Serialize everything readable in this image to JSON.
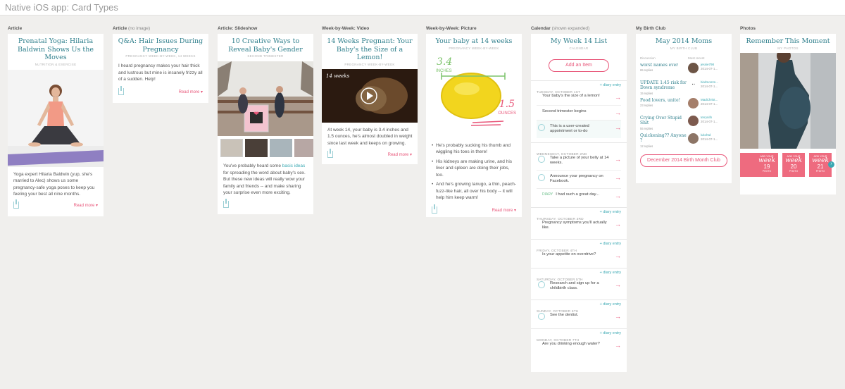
{
  "page": {
    "title": "Native iOS app: Card Types"
  },
  "columns": {
    "article": {
      "label": "Article",
      "note": ""
    },
    "qa": {
      "label": "Article",
      "note": "(no image)"
    },
    "slideshow": {
      "label": "Article: Slideshow",
      "note": ""
    },
    "video": {
      "label": "Week-by-Week: Video",
      "note": ""
    },
    "picture": {
      "label": "Week-by-Week: Picture",
      "note": ""
    },
    "calendar": {
      "label": "Calendar",
      "note": "(shown expanded)"
    },
    "club": {
      "label": "My Birth Club",
      "note": ""
    },
    "photos": {
      "label": "Photos",
      "note": ""
    }
  },
  "article": {
    "title": "Prenatal Yoga: Hilaria Baldwin Shows Us the Moves",
    "subtitle": "NUTRITION & EXERCISE",
    "body": "Yoga expert Hilaria Baldwin (yup, she's married to Alec) shows us some pregnancy-safe yoga poses to keep you feeling your best all nine months.",
    "read_more": "Read more"
  },
  "qa": {
    "title": "Q&A: Hair Issues During Pregnancy",
    "subtitle": "PREGNANCY WEEK-BY-WEEK, 14 WEEKS",
    "body": "I heard pregnancy makes your hair thick and lustrous but mine is insanely frizzy all of a sudden. Help!",
    "read_more": "Read more"
  },
  "slideshow": {
    "title": "10 Creative Ways to Reveal Baby's Gender",
    "subtitle": "SECOND TRIMESTER",
    "body_pre": "You've probably heard some ",
    "body_link": "basic ideas",
    "body_post": " for spreading the word about baby's sex. But these new ideas will really wow your family and friends -- and make sharing your surprise even more exciting."
  },
  "video": {
    "title": "14 Weeks Pregnant: Your Baby's the Size of a Lemon!",
    "subtitle": "PREGNANCY WEEK-BY-WEEK",
    "overlay": "14 weeks",
    "body": "At week 14, your baby is 3.4 inches and 1.5 ounces, he's almost doubled in weight since last week and keeps on growing.",
    "read_more": "Read more"
  },
  "picture": {
    "title": "Your baby at 14 weeks",
    "subtitle": "PREGNANCY WEEK-BY-WEEK",
    "inches_value": "3.4",
    "inches_label": "INCHES",
    "ounces_value": "1.5",
    "ounces_label": "OUNCES",
    "bullets": [
      "He's probably sucking his thumb and wiggling his toes in there!",
      "His kidneys are making urine, and his liver and spleen are doing their jobs, too.",
      "And he's growing lanugo, a thin, peach- fuzz-like hair, all over his body -- it will help him keep warm!"
    ],
    "read_more": "Read more"
  },
  "calendar": {
    "title": "My Week 14 List",
    "subtitle": "CALENDAR",
    "add_button": "Add an Item",
    "diary": "+ diary entry",
    "days": [
      {
        "date": "TUESDAY, OCTOBER 1ST",
        "items": [
          "Your baby's the size of a lemon!",
          "Second trimester begins",
          "This is a user-created appointment or to-do"
        ]
      },
      {
        "date": "WEDNESDAY, OCTOBER 2ND",
        "items": [
          "Take a picture of your belly at 14 weeks.",
          "Announce your pregnancy on Facebook.",
          "I had such a great day..."
        ],
        "diary_tag": "DIARY"
      },
      {
        "date": "THURSDAY, OCTOBER 3RD",
        "items": [
          "Pregnancy symptoms you'll actually like."
        ]
      },
      {
        "date": "FRIDAY, OCTOBER 4TH",
        "items": [
          "Is your appetite on overdrive?"
        ]
      },
      {
        "date": "SATURDAY, OCTOBER 5TH",
        "items": [
          "Research and sign up for a childbirth class."
        ]
      },
      {
        "date": "SUNDAY, OCTOBER 6TH",
        "items": [
          "See the dentist."
        ]
      },
      {
        "date": "MONDAY, OCTOBER 7TH",
        "items": [
          "Are you drinking enough water?"
        ]
      }
    ]
  },
  "club": {
    "title": "May 2014 Moms",
    "subtitle": "MY BIRTH CLUB",
    "col_discussion": "Discussion",
    "col_recent": "Most recent",
    "threads": [
      {
        "title": "worst names ever",
        "replies": "65 replies",
        "user": "jessie798",
        "date": "2014-07-1..."
      },
      {
        "title": "UPDATE 1:45 risk for Down syndrome",
        "replies": "15 replies",
        "user": "birdmomm...",
        "date": "2014-07-1..."
      },
      {
        "title": "Food lovers, unite!",
        "replies": "23 replies",
        "user": "MadChrist...",
        "date": "2014-07-1..."
      },
      {
        "title": "Crying Over Stupid Shit",
        "replies": "55 replies",
        "user": "terrynifn",
        "date": "2014-07-1..."
      },
      {
        "title": "Quickening?? Anyone ?",
        "replies": "12 replies",
        "user": "lukchtd",
        "date": "2014-07-1..."
      }
    ],
    "button": "December 2014 Birth Month Club"
  },
  "photos": {
    "title": "Remember This Moment",
    "subtitle": "MY PHOTOS",
    "tiles": [
      {
        "add": "ADD YOUR",
        "word": "week",
        "num": "19",
        "kind": "PHOTO"
      },
      {
        "add": "ADD YOUR",
        "word": "week",
        "num": "20",
        "kind": "PHOTO"
      },
      {
        "add": "ADD YOUR",
        "word": "week",
        "num": "21",
        "kind": "PHOTO"
      }
    ]
  },
  "colors": {
    "accent": "#2f7f8c",
    "link": "#3aa8b2",
    "cta": "#e8577a",
    "background": "#f0efed"
  }
}
